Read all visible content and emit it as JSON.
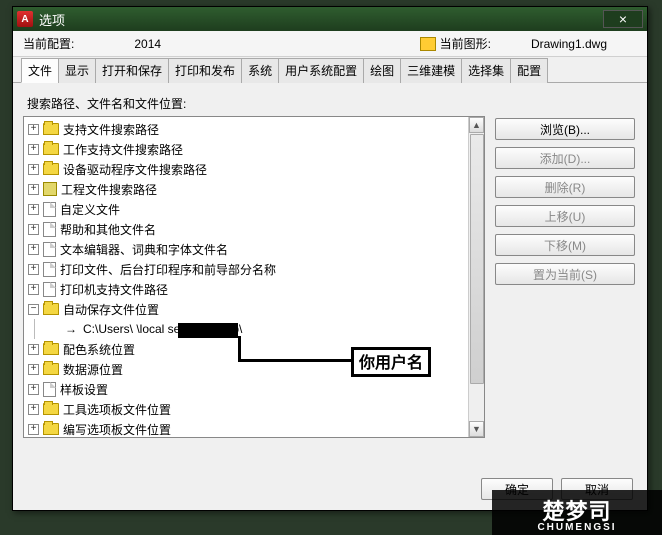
{
  "window": {
    "title": "选项",
    "close": "×"
  },
  "info": {
    "config_label": "当前配置:",
    "config_value": "2014",
    "drawing_label": "当前图形:",
    "drawing_value": "Drawing1.dwg"
  },
  "tabs": [
    {
      "label": "文件",
      "active": true
    },
    {
      "label": "显示"
    },
    {
      "label": "打开和保存"
    },
    {
      "label": "打印和发布"
    },
    {
      "label": "系统"
    },
    {
      "label": "用户系统配置"
    },
    {
      "label": "绘图"
    },
    {
      "label": "三维建模"
    },
    {
      "label": "选择集"
    },
    {
      "label": "配置"
    }
  ],
  "panel": {
    "label": "搜索路径、文件名和文件位置:"
  },
  "tree": [
    {
      "toggle": "+",
      "icon": "folder",
      "label": "支持文件搜索路径",
      "indent": 0
    },
    {
      "toggle": "+",
      "icon": "folder",
      "label": "工作支持文件搜索路径",
      "indent": 0
    },
    {
      "toggle": "+",
      "icon": "folder",
      "label": "设备驱动程序文件搜索路径",
      "indent": 0
    },
    {
      "toggle": "+",
      "icon": "book",
      "label": "工程文件搜索路径",
      "indent": 0
    },
    {
      "toggle": "+",
      "icon": "doc",
      "label": "自定义文件",
      "indent": 0
    },
    {
      "toggle": "+",
      "icon": "doc",
      "label": "帮助和其他文件名",
      "indent": 0
    },
    {
      "toggle": "+",
      "icon": "doc",
      "label": "文本编辑器、词典和字体文件名",
      "indent": 0
    },
    {
      "toggle": "+",
      "icon": "doc",
      "label": "打印文件、后台打印程序和前导部分名称",
      "indent": 0
    },
    {
      "toggle": "+",
      "icon": "doc",
      "label": "打印机支持文件路径",
      "indent": 0
    },
    {
      "toggle": "−",
      "icon": "folder",
      "label": "自动保存文件位置",
      "indent": 0
    },
    {
      "toggle": "",
      "icon": "arrow",
      "label": "C:\\Users\\           \\local settings\\temp\\",
      "indent": 1
    },
    {
      "toggle": "+",
      "icon": "folder",
      "label": "配色系统位置",
      "indent": 0
    },
    {
      "toggle": "+",
      "icon": "folder",
      "label": "数据源位置",
      "indent": 0
    },
    {
      "toggle": "+",
      "icon": "doc",
      "label": "样板设置",
      "indent": 0
    },
    {
      "toggle": "+",
      "icon": "folder",
      "label": "工具选项板文件位置",
      "indent": 0
    },
    {
      "toggle": "+",
      "icon": "folder",
      "label": "编写选项板文件位置",
      "indent": 0
    }
  ],
  "buttons": {
    "browse": "浏览(B)...",
    "add": "添加(D)...",
    "remove": "删除(R)",
    "moveup": "上移(U)",
    "movedown": "下移(M)",
    "setcurrent": "置为当前(S)"
  },
  "footer": {
    "ok": "确定",
    "cancel": "取消"
  },
  "annotation": {
    "text": "你用户名"
  },
  "watermark": {
    "brand": "楚梦司",
    "sub": "CHUMENGSI"
  }
}
